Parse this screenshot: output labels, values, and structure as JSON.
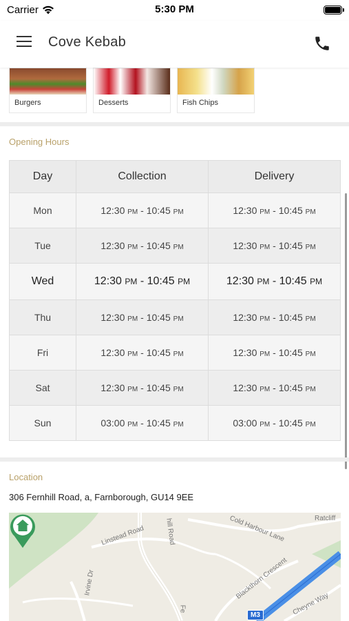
{
  "status_bar": {
    "carrier": "Carrier",
    "time": "5:30 PM"
  },
  "header": {
    "title": "Cove Kebab",
    "menu_icon": "hamburger-menu-icon",
    "call_icon": "phone-icon"
  },
  "categories": [
    {
      "label": "Burgers"
    },
    {
      "label": "Desserts"
    },
    {
      "label": "Fish  Chips"
    }
  ],
  "opening_hours": {
    "label": "Opening Hours",
    "columns": [
      "Day",
      "Collection",
      "Delivery"
    ],
    "rows": [
      {
        "day": "Mon",
        "collection": {
          "from": "12:30",
          "from_ampm": "PM",
          "to": "10:45",
          "to_ampm": "PM"
        },
        "delivery": {
          "from": "12:30",
          "from_ampm": "PM",
          "to": "10:45",
          "to_ampm": "PM"
        }
      },
      {
        "day": "Tue",
        "collection": {
          "from": "12:30",
          "from_ampm": "PM",
          "to": "10:45",
          "to_ampm": "PM"
        },
        "delivery": {
          "from": "12:30",
          "from_ampm": "PM",
          "to": "10:45",
          "to_ampm": "PM"
        }
      },
      {
        "day": "Wed",
        "collection": {
          "from": "12:30",
          "from_ampm": "PM",
          "to": "10:45",
          "to_ampm": "PM"
        },
        "delivery": {
          "from": "12:30",
          "from_ampm": "PM",
          "to": "10:45",
          "to_ampm": "PM"
        }
      },
      {
        "day": "Thu",
        "collection": {
          "from": "12:30",
          "from_ampm": "PM",
          "to": "10:45",
          "to_ampm": "PM"
        },
        "delivery": {
          "from": "12:30",
          "from_ampm": "PM",
          "to": "10:45",
          "to_ampm": "PM"
        }
      },
      {
        "day": "Fri",
        "collection": {
          "from": "12:30",
          "from_ampm": "PM",
          "to": "10:45",
          "to_ampm": "PM"
        },
        "delivery": {
          "from": "12:30",
          "from_ampm": "PM",
          "to": "10:45",
          "to_ampm": "PM"
        }
      },
      {
        "day": "Sat",
        "collection": {
          "from": "12:30",
          "from_ampm": "PM",
          "to": "10:45",
          "to_ampm": "PM"
        },
        "delivery": {
          "from": "12:30",
          "from_ampm": "PM",
          "to": "10:45",
          "to_ampm": "PM"
        }
      },
      {
        "day": "Sun",
        "collection": {
          "from": "03:00",
          "from_ampm": "PM",
          "to": "10:45",
          "to_ampm": "PM"
        },
        "delivery": {
          "from": "03:00",
          "from_ampm": "PM",
          "to": "10:45",
          "to_ampm": "PM"
        }
      }
    ]
  },
  "location": {
    "label": "Location",
    "address": "306 Fernhill Road, a, Farnborough, GU14 9EE",
    "map": {
      "streets": [
        "Linstead Road",
        "hill Road",
        "Cold Harbour Lane",
        "Ratcliff",
        "Irvine Dr",
        "Blackthorn Crescent",
        "Cheyne Way",
        "Fe"
      ],
      "motorway": "M3",
      "marker_icon": "home-pin-icon"
    }
  },
  "colors": {
    "section_label": "#b9a16a",
    "motorway": "#2a6bd1",
    "marker": "#3a9b5c"
  }
}
